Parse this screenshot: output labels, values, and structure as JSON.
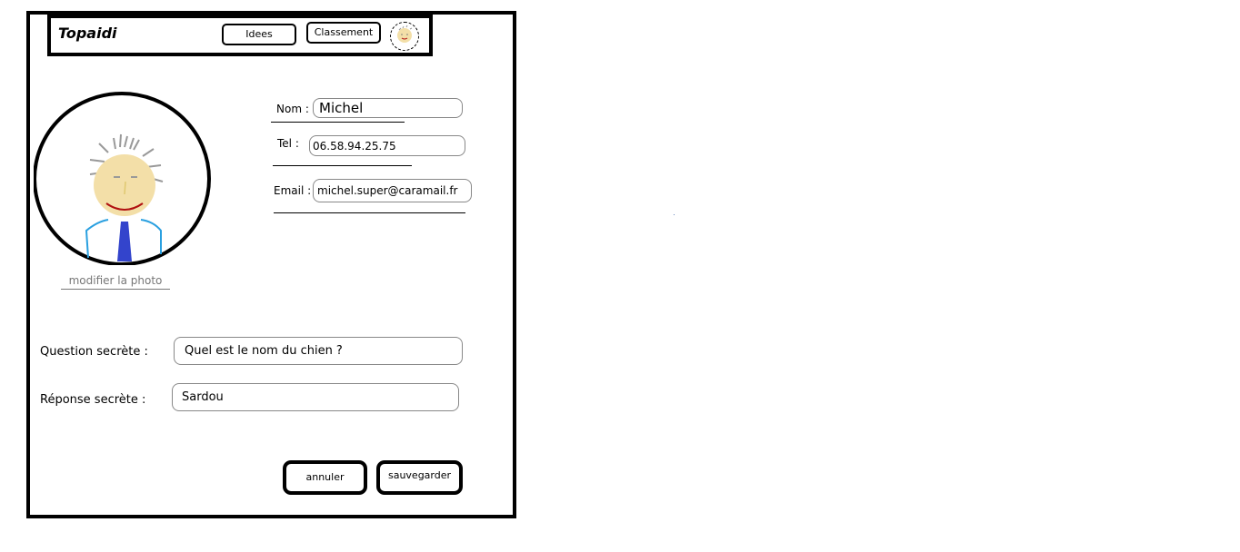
{
  "header": {
    "brand": "Topaidi",
    "nav": {
      "ideas_label": "Idees",
      "ranking_label": "Classement"
    }
  },
  "profile": {
    "change_photo_label": "modifier la photo"
  },
  "form": {
    "name_label": "Nom :",
    "name_value": "Michel",
    "phone_label": "Tel :",
    "phone_value": "06.58.94.25.75",
    "email_label": "Email :",
    "email_value": "michel.super@caramail.fr",
    "secret_question_label": "Question secrète :",
    "secret_question_value": "Quel est le nom du chien ?",
    "secret_answer_label": "Réponse secrète :",
    "secret_answer_value": "Sardou"
  },
  "actions": {
    "cancel_label": "annuler",
    "save_label": "sauvegarder"
  },
  "icons": {
    "avatar": "avatar-icon",
    "mini_avatar": "profile-avatar-icon"
  },
  "colors": {
    "border": "#000000",
    "link": "#777777",
    "face": "#f3dfa8",
    "shirt": "#2aa0e0",
    "tie": "#3344cc",
    "mouth": "#b01010",
    "hair": "#999999"
  }
}
